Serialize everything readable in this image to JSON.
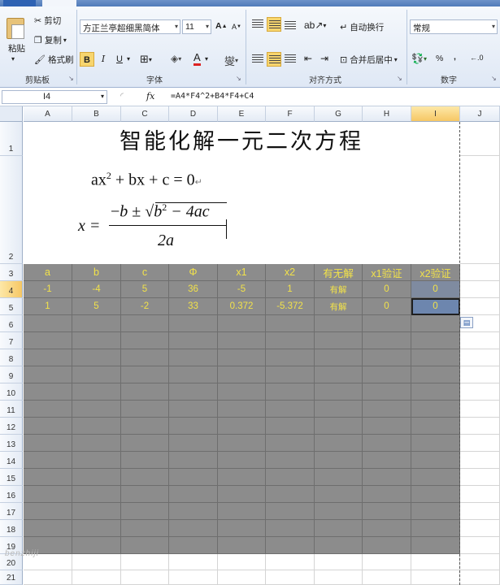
{
  "ribbon": {
    "clipboard": {
      "paste": "粘贴",
      "cut": "剪切",
      "copy": "复制",
      "format_painter": "格式刷",
      "label": "剪贴板"
    },
    "font": {
      "family": "方正兰亭超细黑简体",
      "size": "11",
      "bold": "B",
      "italic": "I",
      "underline": "U",
      "font_color": "A",
      "phonetic": "燮",
      "label": "字体"
    },
    "alignment": {
      "wrap_text": "自动换行",
      "merge_center": "合并后居中",
      "label": "对齐方式"
    },
    "number": {
      "format": "常规",
      "percent": "%",
      "comma": ",",
      "label": "数字"
    }
  },
  "formula_bar": {
    "name_box": "I4",
    "fx": "fx",
    "formula": "=A4*F4^2+B4*F4+C4"
  },
  "columns": [
    "A",
    "B",
    "C",
    "D",
    "E",
    "F",
    "G",
    "H",
    "I",
    "J"
  ],
  "rows": [
    "1",
    "2",
    "3",
    "4",
    "5",
    "6",
    "7",
    "8",
    "9",
    "10",
    "11",
    "12",
    "13",
    "14",
    "15",
    "16",
    "17",
    "18",
    "19",
    "20",
    "21"
  ],
  "sheet": {
    "title": "智能化解一元二次方程",
    "equation": {
      "lhs": "ax",
      "exp": "2",
      "rest": " + bx + c = 0",
      "mark": "↵"
    },
    "quadratic": {
      "x": "x =",
      "num_pre": "−",
      "b": "b",
      "pm": " ± √",
      "b2": "b",
      "sq": "2",
      "rest": " − 4ac",
      "den": "2a"
    },
    "headers": [
      "a",
      "b",
      "c",
      "Φ",
      "x1",
      "x2",
      "有无解",
      "x1验证",
      "x2验证"
    ],
    "row4": [
      "-1",
      "-4",
      "5",
      "36",
      "-5",
      "1",
      "有解",
      "0",
      "0"
    ],
    "row5": [
      "1",
      "5",
      "-2",
      "33",
      "0.372",
      "-5.372",
      "有解",
      "0",
      "0"
    ]
  },
  "watermark": "benzhiji"
}
